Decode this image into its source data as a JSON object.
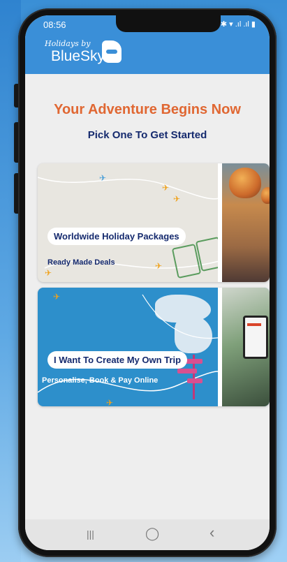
{
  "status_bar": {
    "time": "08:56",
    "icons": "✱ ▾ .ıl .ıl ▮"
  },
  "app": {
    "logo_small": "Holidays by",
    "logo_brand": "BlueSky"
  },
  "hero": {
    "title": "Your Adventure Begins Now",
    "subtitle": "Pick One To Get Started"
  },
  "cards": [
    {
      "label": "Worldwide Holiday Packages",
      "sub": "Ready Made Deals"
    },
    {
      "label": "I Want To Create My Own Trip",
      "sub": "Personalise, Book & Pay Online"
    }
  ],
  "nav": {
    "recent": "|||",
    "home": "◯",
    "back": "‹"
  },
  "colors": {
    "brand_blue": "#3a8fd8",
    "accent_orange": "#e06732",
    "navy": "#152a6e",
    "card_blue": "#2d8fcb"
  }
}
